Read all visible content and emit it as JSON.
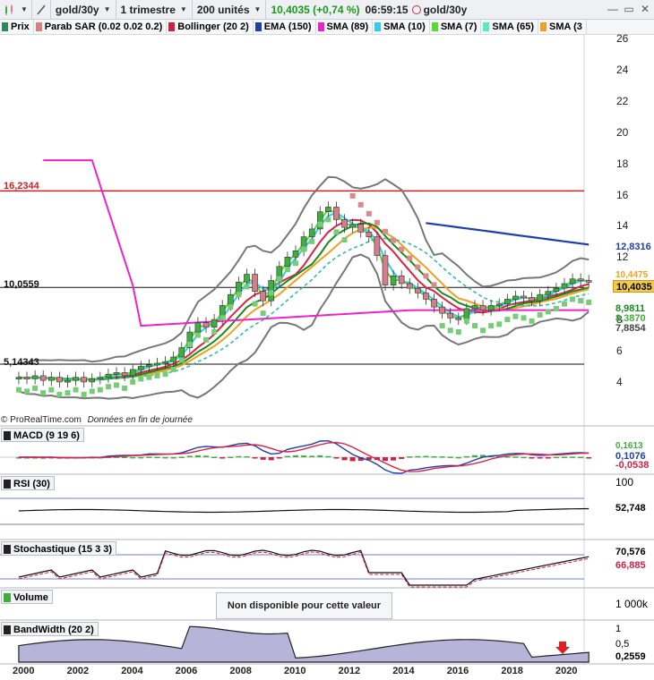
{
  "toolbar": {
    "symbol": "gold/30y",
    "period": "1 trimestre",
    "units": "200 unités",
    "quote": "10,4035 (+0,74 %)",
    "time": "06:59:15",
    "instrument": "gold/30y"
  },
  "legend": [
    {
      "label": "Prix",
      "color": "#2e8b57"
    },
    {
      "label": "Parab SAR (0.02 0.02 0.2)",
      "color": "#d98080"
    },
    {
      "label": "Bollinger (20 2)",
      "color": "#cc2244"
    },
    {
      "label": "EMA (150)",
      "color": "#1f3fae"
    },
    {
      "label": "SMA (89)",
      "color": "#ee22cc"
    },
    {
      "label": "SMA (10)",
      "color": "#33ccee"
    },
    {
      "label": "SMA (7)",
      "color": "#55dd33"
    },
    {
      "label": "SMA (65)",
      "color": "#55eebb"
    },
    {
      "label": "SMA (3",
      "color": "#f0a020"
    }
  ],
  "notes": {
    "source": "© ProRealTime.com",
    "eod": "Données en fin de journée",
    "unavailable": "Non disponible pour cette valeur"
  },
  "panels": {
    "macd": {
      "label": "MACD (9 19 6)",
      "values": [
        "0,1613",
        "0,1076",
        "-0,0538"
      ]
    },
    "rsi": {
      "label": "RSI (30)",
      "top": "100",
      "value": "52,748"
    },
    "stoch": {
      "label": "Stochastique (15 3 3)",
      "values": [
        "70,576",
        "66,885"
      ]
    },
    "volume": {
      "label": "Volume",
      "axis": "1 000k"
    },
    "bandwidth": {
      "label": "BandWidth (20 2)",
      "values": [
        "1",
        "0,5",
        "0,2559"
      ]
    }
  },
  "price_axis": [
    "26",
    "24",
    "22",
    "20",
    "18",
    "16",
    "14",
    "12",
    "10",
    "8",
    "6",
    "4"
  ],
  "price_labels": {
    "last": "10,4035",
    "ema": "12,8316",
    "l1": "8,9811",
    "l2": "8,3870",
    "l3": "7,8854",
    "hidden": "10,4475",
    "hline_top": "16,2344",
    "hline_mid": "10,0559",
    "hline_bot": "5,14343"
  },
  "years": [
    "2000",
    "2002",
    "2004",
    "2006",
    "2008",
    "2010",
    "2012",
    "2014",
    "2016",
    "2018",
    "2020"
  ],
  "colors": {
    "up": "#3fae3f",
    "down": "#d97b8a",
    "sar": "#d98a8a",
    "sar_low": "#77cc77",
    "boll_outer": "#777777",
    "boll_mid": "#dd2244",
    "ema150": "#1f3fae",
    "sma89": "#ee22cc",
    "sma10": "#33ccee",
    "sma7": "#55dd33",
    "sma65": "#33bbaa",
    "sma_orange": "#f0a020",
    "sma_dark": "#1a8a1a"
  },
  "chart_data": {
    "type": "line",
    "x": [
      1999.8,
      2000.1,
      2000.4,
      2000.7,
      2001.0,
      2001.3,
      2001.6,
      2001.9,
      2002.2,
      2002.5,
      2002.8,
      2003.1,
      2003.4,
      2003.7,
      2004.0,
      2004.3,
      2004.6,
      2004.9,
      2005.2,
      2005.5,
      2005.8,
      2006.1,
      2006.4,
      2006.7,
      2007.0,
      2007.3,
      2007.6,
      2007.9,
      2008.2,
      2008.5,
      2008.8,
      2009.1,
      2009.4,
      2009.7,
      2010.0,
      2010.3,
      2010.6,
      2010.9,
      2011.2,
      2011.5,
      2011.8,
      2012.1,
      2012.4,
      2012.7,
      2013.0,
      2013.3,
      2013.6,
      2013.9,
      2014.2,
      2014.5,
      2014.8,
      2015.1,
      2015.4,
      2015.7,
      2016.0,
      2016.3,
      2016.6,
      2016.9,
      2017.2,
      2017.5,
      2017.8,
      2018.1,
      2018.4,
      2018.7,
      2019.0,
      2019.3,
      2019.6,
      2019.9,
      2020.2,
      2020.5,
      2020.8
    ],
    "close": [
      4.3,
      4.2,
      4.4,
      4.1,
      4.3,
      4.0,
      4.1,
      4.3,
      4.0,
      4.2,
      4.3,
      4.5,
      4.6,
      4.4,
      4.8,
      5.0,
      5.1,
      5.2,
      5.3,
      5.6,
      6.2,
      7.2,
      7.8,
      7.5,
      8.0,
      8.9,
      9.6,
      10.4,
      10.9,
      9.8,
      9.2,
      10.5,
      11.4,
      12.0,
      12.4,
      13.3,
      13.8,
      14.9,
      15.2,
      14.4,
      13.9,
      14.1,
      13.6,
      13.3,
      12.1,
      10.2,
      10.8,
      10.3,
      10.0,
      9.7,
      9.3,
      8.8,
      8.4,
      8.1,
      8.0,
      8.7,
      8.9,
      8.6,
      8.9,
      9.0,
      9.3,
      9.5,
      9.4,
      9.2,
      9.6,
      9.8,
      10.0,
      10.3,
      10.6,
      10.5,
      10.4
    ],
    "price_ylim": [
      3,
      27
    ]
  }
}
